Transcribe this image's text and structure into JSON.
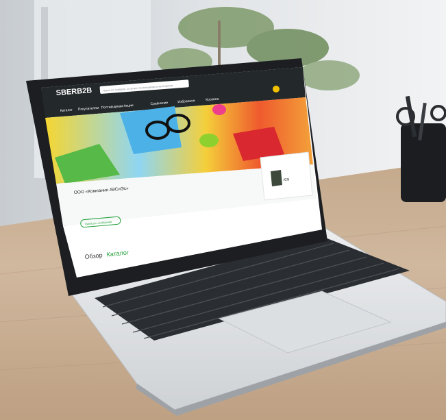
{
  "header": {
    "logo": "SBERB2B",
    "search_placeholder": "Поиск по товарам, услугам, поставщикам и категориям",
    "nav": [
      "Каталог",
      "Покупателям",
      "Поставщикам",
      "Акции"
    ],
    "icons": [
      {
        "name": "compare-icon",
        "label": "Сравнение"
      },
      {
        "name": "favorites-icon",
        "label": "Избранное"
      },
      {
        "name": "cart-icon",
        "label": "Корзина"
      }
    ],
    "accent": "#21a038",
    "bar_color": "#23282b"
  },
  "company": {
    "name": "ООО «Компания АйСиЭс»",
    "contact_button": "Написать сообщение",
    "logo_text": "ICS"
  },
  "tabs": {
    "overview": "Обзор",
    "catalog": "Каталог"
  }
}
